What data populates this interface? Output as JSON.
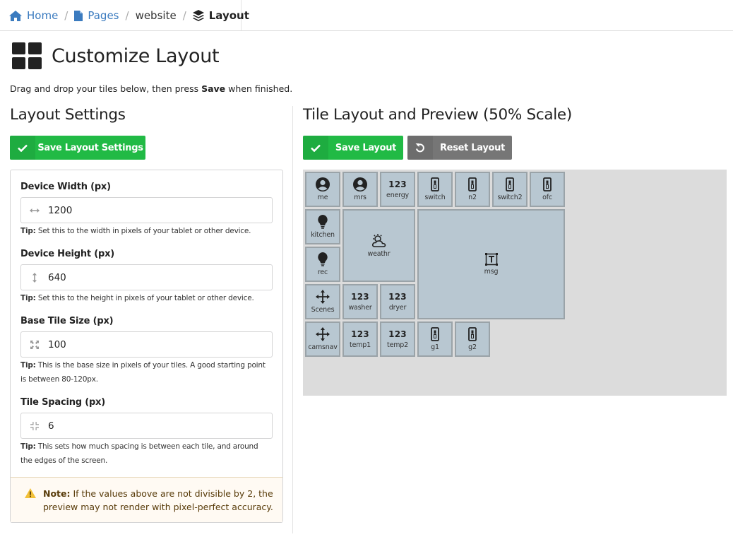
{
  "breadcrumb": {
    "home": "Home",
    "pages": "Pages",
    "website": "website",
    "current": "Layout"
  },
  "page": {
    "title": "Customize Layout",
    "intro_before": "Drag and drop your tiles below, then press ",
    "intro_bold": "Save",
    "intro_after": " when finished."
  },
  "left": {
    "heading": "Layout Settings",
    "save_button": "Save Layout Settings",
    "fields": [
      {
        "label": "Device Width (px)",
        "value": "1200",
        "icon": "arrows-horizontal-icon",
        "tip_bold": "Tip:",
        "tip": " Set this to the width in pixels of your tablet or other device."
      },
      {
        "label": "Device Height (px)",
        "value": "640",
        "icon": "arrows-vertical-icon",
        "tip_bold": "Tip:",
        "tip": " Set this to the height in pixels of your tablet or other device."
      },
      {
        "label": "Base Tile Size (px)",
        "value": "100",
        "icon": "expand-icon",
        "tip_bold": "Tip:",
        "tip": " This is the base size in pixels of your tiles. A good starting point is between 80-120px."
      },
      {
        "label": "Tile Spacing (px)",
        "value": "6",
        "icon": "compress-icon",
        "tip_bold": "Tip:",
        "tip": " This sets how much spacing is between each tile, and around the edges of the screen."
      }
    ],
    "note_bold": "Note:",
    "note": " If the values above are not divisible by 2, the preview may not render with pixel-perfect accuracy."
  },
  "right": {
    "heading": "Tile Layout and Preview (50% Scale)",
    "save_button": "Save Layout",
    "reset_button": "Reset Layout",
    "colors": {
      "preview_bg": "#dcdcdc",
      "tile_bg": "#b8c7d1",
      "tile_border": "#9aa3a8"
    },
    "tiles": [
      {
        "label": "me",
        "icon": "user-icon"
      },
      {
        "label": "mrs",
        "icon": "user-icon"
      },
      {
        "label": "energy",
        "icon": "number-icon",
        "glyph": "123"
      },
      {
        "label": "switch",
        "icon": "switch-icon"
      },
      {
        "label": "n2",
        "icon": "switch-icon"
      },
      {
        "label": "switch2",
        "icon": "switch-icon"
      },
      {
        "label": "ofc",
        "icon": "switch-icon"
      },
      {
        "label": "kitchen",
        "icon": "bulb-icon"
      },
      {
        "label": "weathr",
        "icon": "weather-icon"
      },
      {
        "label": "msg",
        "icon": "text-icon"
      },
      {
        "label": "rec",
        "icon": "bulb-icon"
      },
      {
        "label": "Scenes",
        "icon": "arrows-icon"
      },
      {
        "label": "washer",
        "icon": "number-icon",
        "glyph": "123"
      },
      {
        "label": "dryer",
        "icon": "number-icon",
        "glyph": "123"
      },
      {
        "label": "camsnav",
        "icon": "arrows-icon"
      },
      {
        "label": "temp1",
        "icon": "number-icon",
        "glyph": "123"
      },
      {
        "label": "temp2",
        "icon": "number-icon",
        "glyph": "123"
      },
      {
        "label": "g1",
        "icon": "switch-icon"
      },
      {
        "label": "g2",
        "icon": "switch-icon"
      }
    ]
  }
}
